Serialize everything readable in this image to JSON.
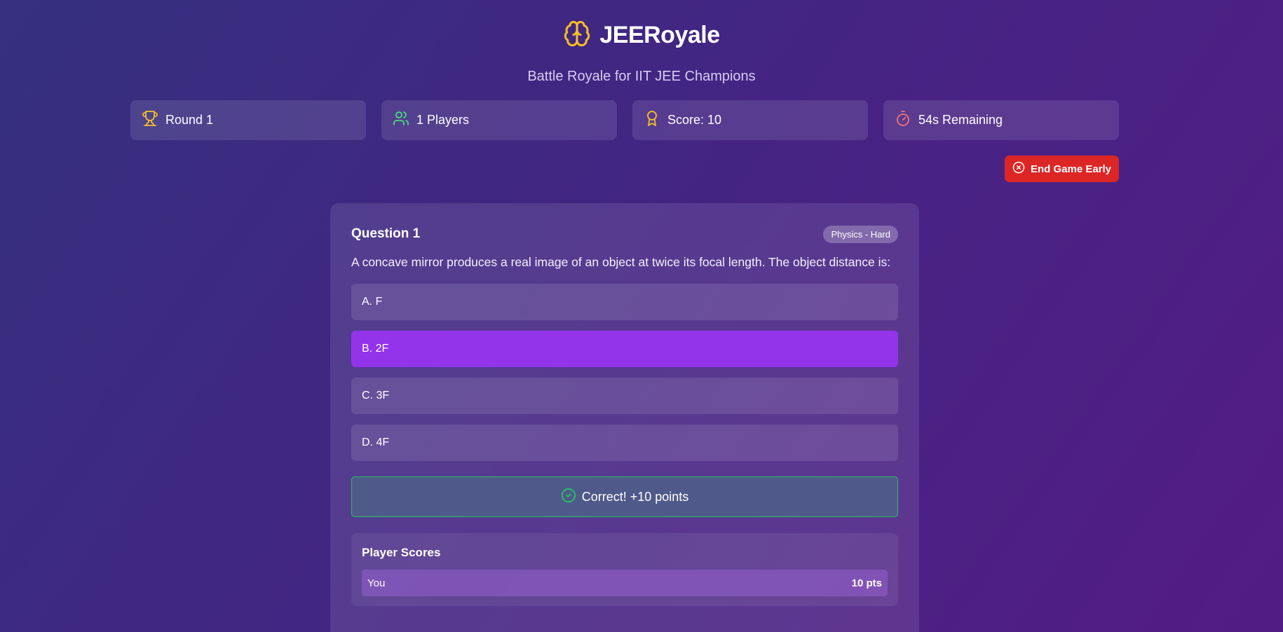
{
  "app": {
    "title": "JEERoyale",
    "subtitle": "Battle Royale for IIT JEE Champions",
    "logo_icon": "brain-icon"
  },
  "stats": {
    "round": "Round 1",
    "players": "1 Players",
    "score": "Score: 10",
    "timer": "54s Remaining"
  },
  "actions": {
    "end_game_label": "End Game Early"
  },
  "question": {
    "title": "Question 1",
    "tag": "Physics - Hard",
    "text": "A concave mirror produces a real image of an object at twice its focal length. The object distance is:",
    "options": [
      {
        "label": "A. F",
        "selected": false
      },
      {
        "label": "B. 2F",
        "selected": true
      },
      {
        "label": "C. 3F",
        "selected": false
      },
      {
        "label": "D. 4F",
        "selected": false
      }
    ],
    "feedback": "Correct! +10 points"
  },
  "scoreboard": {
    "title": "Player Scores",
    "rows": [
      {
        "player": "You",
        "points": "10 pts"
      }
    ]
  },
  "colors": {
    "accent": "#9333ea",
    "danger": "#dc2626",
    "success": "#22c55e",
    "gold": "#fbbf24",
    "green_icon": "#4ade80",
    "red_icon": "#f87171"
  }
}
